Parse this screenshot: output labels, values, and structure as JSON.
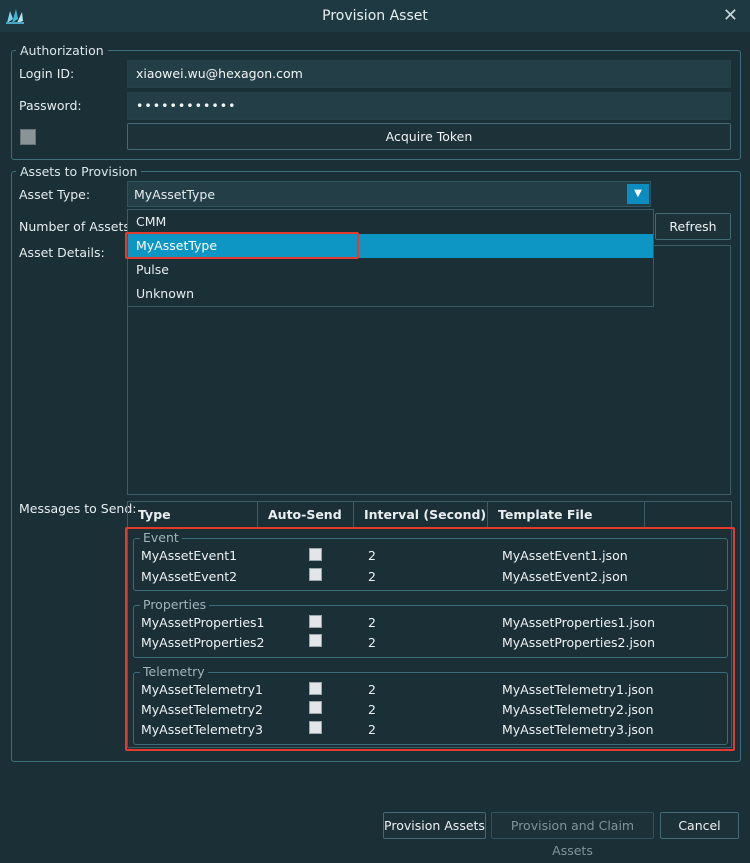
{
  "window": {
    "title": "Provision Asset",
    "icon": "hexagon-logo-icon",
    "close_icon": "close-icon"
  },
  "authorization": {
    "legend": "Authorization",
    "login_label": "Login ID:",
    "login_value": "xiaowei.wu@hexagon.com",
    "password_label": "Password:",
    "password_value": "••••••••••••",
    "acquire_label": "Acquire Token"
  },
  "assets": {
    "legend": "Assets to Provision",
    "asset_type_label": "Asset Type:",
    "asset_type_value": "MyAssetType",
    "number_label": "Number of Assets:",
    "details_label": "Asset Details:",
    "refresh_label": "Refresh",
    "dropdown_options": [
      "CMM",
      "MyAssetType",
      "Pulse",
      "Unknown"
    ],
    "messages_label": "Messages to Send:"
  },
  "messages": {
    "columns": [
      "Type",
      "Auto-Send",
      "Interval (Second)",
      "Template File"
    ],
    "groups": [
      {
        "name": "Event",
        "rows": [
          {
            "type": "MyAssetEvent1",
            "interval": "2",
            "template": "MyAssetEvent1.json"
          },
          {
            "type": "MyAssetEvent2",
            "interval": "2",
            "template": "MyAssetEvent2.json"
          }
        ]
      },
      {
        "name": "Properties",
        "rows": [
          {
            "type": "MyAssetProperties1",
            "interval": "2",
            "template": "MyAssetProperties1.json"
          },
          {
            "type": "MyAssetProperties2",
            "interval": "2",
            "template": "MyAssetProperties2.json"
          }
        ]
      },
      {
        "name": "Telemetry",
        "rows": [
          {
            "type": "MyAssetTelemetry1",
            "interval": "2",
            "template": "MyAssetTelemetry1.json"
          },
          {
            "type": "MyAssetTelemetry2",
            "interval": "2",
            "template": "MyAssetTelemetry2.json"
          },
          {
            "type": "MyAssetTelemetry3",
            "interval": "2",
            "template": "MyAssetTelemetry3.json"
          }
        ]
      }
    ]
  },
  "footer": {
    "provision_label": "Provision Assets",
    "provision_claim_label": "Provision and Claim Assets",
    "cancel_label": "Cancel"
  },
  "colors": {
    "accent": "#0d96c4",
    "highlight": "#e53b2f",
    "background": "#1b2f37"
  }
}
